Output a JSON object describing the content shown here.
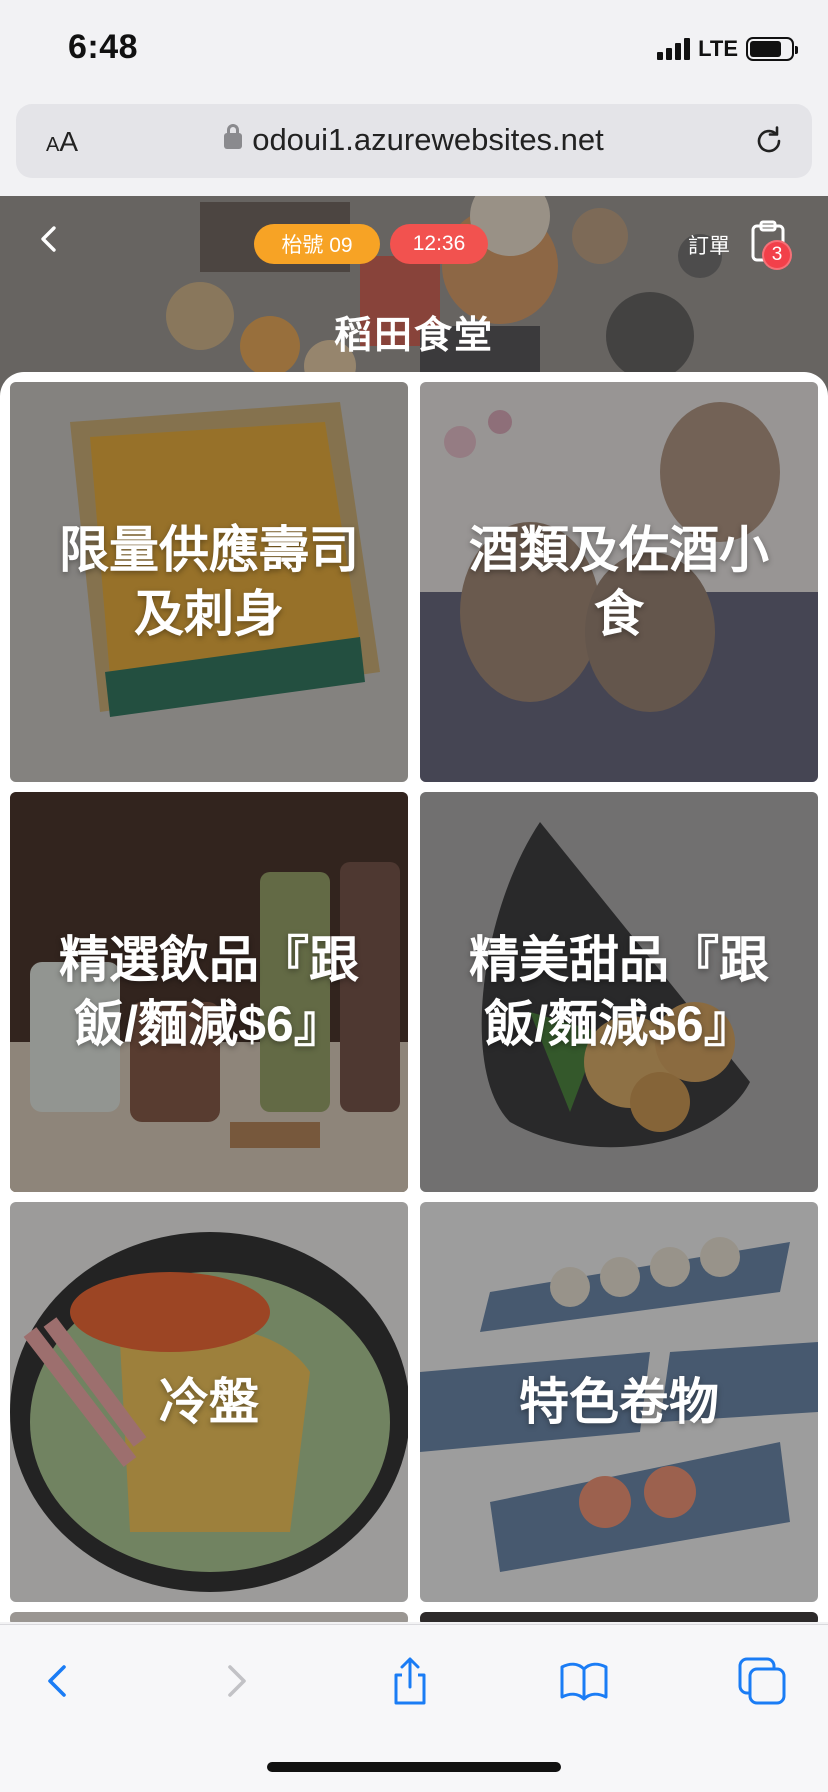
{
  "status_bar": {
    "time": "6:48",
    "network": "LTE"
  },
  "browser": {
    "text_size_label": "AA",
    "url": "odoui1.azurewebsites.net"
  },
  "header": {
    "table_badge": "枱號 09",
    "time_badge": "12:36",
    "order_label": "訂單",
    "order_count": "3",
    "store_name": "稻田食堂"
  },
  "categories": [
    {
      "label": "限量供應壽司及刺身"
    },
    {
      "label": "酒類及佐酒小食"
    },
    {
      "label": "精選飲品『跟飯/麵減$6』"
    },
    {
      "label": "精美甜品『跟飯/麵減$6』"
    },
    {
      "label": "冷盤"
    },
    {
      "label": "特色卷物"
    }
  ],
  "colors": {
    "table_badge": "#f7a325",
    "time_badge": "#f2524f",
    "order_count_badge": "#f2404a",
    "ios_blue": "#1a7cf5"
  },
  "icons": [
    "back-icon",
    "forward-icon",
    "share-icon",
    "bookmarks-icon",
    "tabs-icon",
    "reload-icon",
    "lock-icon",
    "clipboard-icon",
    "chevron-left-icon"
  ]
}
